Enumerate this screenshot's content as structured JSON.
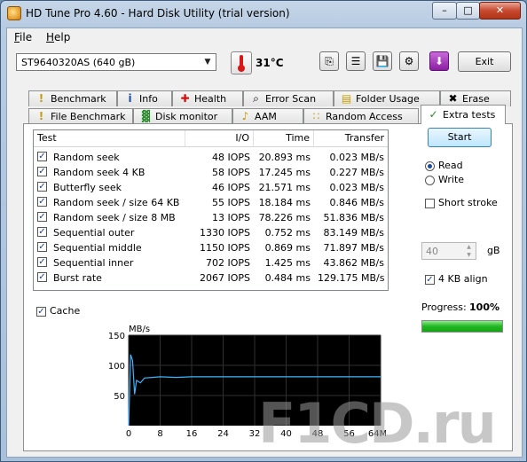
{
  "window": {
    "title": "HD Tune Pro 4.60 - Hard Disk Utility (trial version)",
    "minimize": "–",
    "maximize": "□",
    "close": "✕"
  },
  "menu": [
    "File",
    "Help"
  ],
  "toolbar": {
    "drive": "ST9640320AS (640 gB)",
    "temperature": "31°C",
    "buttons": [
      {
        "name": "copy-info-icon",
        "glyph": "⎘"
      },
      {
        "name": "copy-text-icon",
        "glyph": "☰"
      },
      {
        "name": "save-icon",
        "glyph": "💾"
      },
      {
        "name": "options-icon",
        "glyph": "⚙"
      },
      {
        "name": "download-icon",
        "glyph": "⬇"
      }
    ],
    "exit_label": "Exit"
  },
  "tabs_row1": [
    {
      "label": "Benchmark",
      "icon": "!"
    },
    {
      "label": "Info",
      "icon": "i"
    },
    {
      "label": "Health",
      "icon": "✚"
    },
    {
      "label": "Error Scan",
      "icon": "⌕"
    },
    {
      "label": "Folder Usage",
      "icon": "▤"
    },
    {
      "label": "Erase",
      "icon": "✖"
    }
  ],
  "tabs_row2": [
    {
      "label": "File Benchmark",
      "icon": "!"
    },
    {
      "label": "Disk monitor",
      "icon": "▓"
    },
    {
      "label": "AAM",
      "icon": "♪"
    },
    {
      "label": "Random Access",
      "icon": "∷"
    },
    {
      "label": "Extra tests",
      "icon": "✓"
    }
  ],
  "results": {
    "headers": {
      "test": "Test",
      "io": "I/O",
      "time": "Time",
      "transfer": "Transfer"
    },
    "rows": [
      {
        "test": "Random seek",
        "io": "48 IOPS",
        "time": "20.893 ms",
        "transfer": "0.023 MB/s",
        "checked": true
      },
      {
        "test": "Random seek 4 KB",
        "io": "58 IOPS",
        "time": "17.245 ms",
        "transfer": "0.227 MB/s",
        "checked": true
      },
      {
        "test": "Butterfly seek",
        "io": "46 IOPS",
        "time": "21.571 ms",
        "transfer": "0.023 MB/s",
        "checked": true
      },
      {
        "test": "Random seek / size 64 KB",
        "io": "55 IOPS",
        "time": "18.184 ms",
        "transfer": "0.846 MB/s",
        "checked": true
      },
      {
        "test": "Random seek / size 8 MB",
        "io": "13 IOPS",
        "time": "78.226 ms",
        "transfer": "51.836 MB/s",
        "checked": true
      },
      {
        "test": "Sequential outer",
        "io": "1330 IOPS",
        "time": "0.752 ms",
        "transfer": "83.149 MB/s",
        "checked": true
      },
      {
        "test": "Sequential middle",
        "io": "1150 IOPS",
        "time": "0.869 ms",
        "transfer": "71.897 MB/s",
        "checked": true
      },
      {
        "test": "Sequential inner",
        "io": "702 IOPS",
        "time": "1.425 ms",
        "transfer": "43.862 MB/s",
        "checked": true
      },
      {
        "test": "Burst rate",
        "io": "2067 IOPS",
        "time": "0.484 ms",
        "transfer": "129.175 MB/s",
        "checked": true
      }
    ]
  },
  "cache_label": "Cache",
  "controls": {
    "start": "Start",
    "read": "Read",
    "write": "Write",
    "short_stroke": "Short stroke",
    "stroke_value": "40",
    "stroke_unit": "gB",
    "align": "4 KB align",
    "progress_label": "Progress:",
    "progress_value": "100%",
    "progress_fraction": 1.0
  },
  "chart_data": {
    "type": "line",
    "ylabel": "MB/s",
    "y_ticks": [
      150,
      100,
      50
    ],
    "x_ticks": [
      "0",
      "8",
      "16",
      "24",
      "32",
      "40",
      "48",
      "56",
      "64MB"
    ],
    "ylim": [
      0,
      150
    ],
    "xlim": [
      0,
      64
    ],
    "series": [
      {
        "x": [
          0,
          0.5,
          1,
          1.5,
          2,
          3,
          4,
          6,
          8,
          12,
          16,
          24,
          32,
          40,
          48,
          56,
          64
        ],
        "y": [
          0,
          118,
          108,
          52,
          75,
          71,
          79,
          80,
          81,
          80,
          81,
          81,
          81,
          81,
          81,
          81,
          81
        ]
      }
    ],
    "grid": true,
    "colors": {
      "background": "#000000",
      "grid": "#2f2f2f",
      "line": "#3fb5ff",
      "axis_text": "#000000"
    }
  },
  "watermark": "F1CD.ru"
}
